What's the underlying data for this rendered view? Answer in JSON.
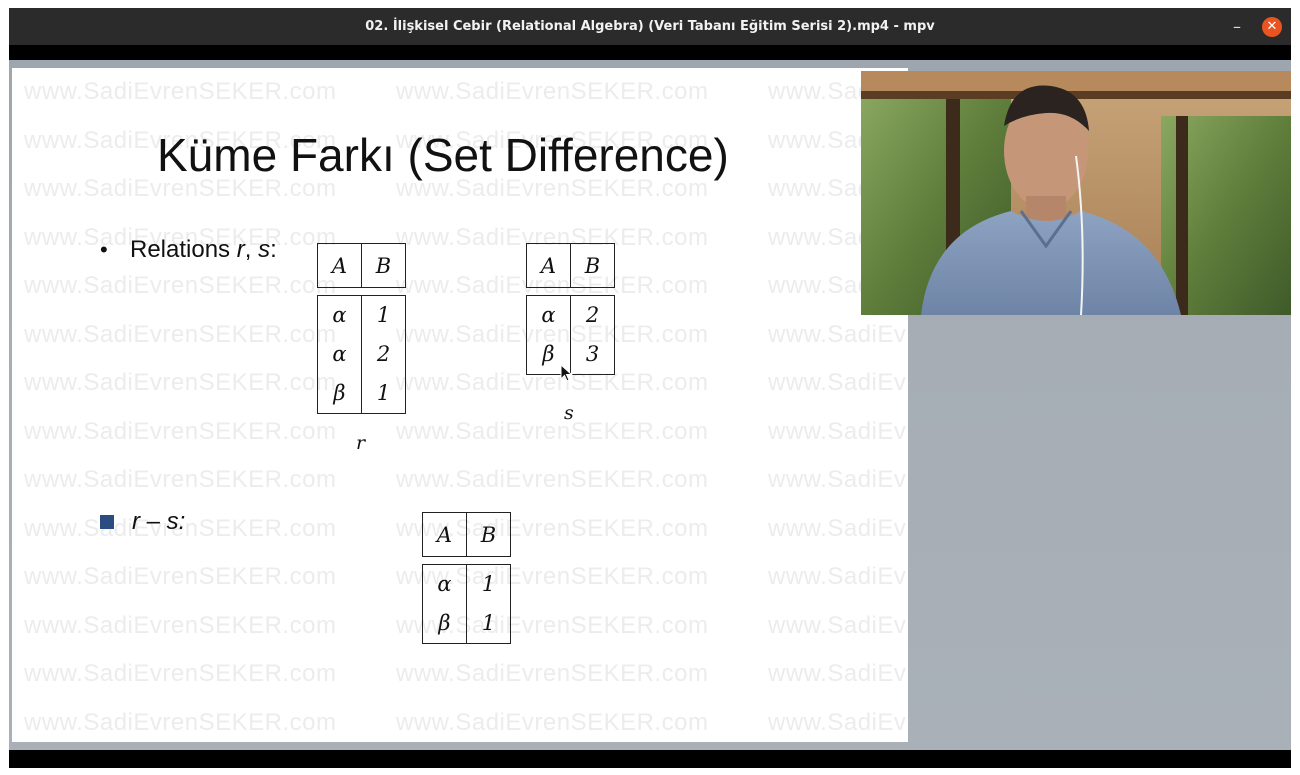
{
  "window": {
    "title": "02. İlişkisel Cebir (Relational Algebra) (Veri Tabanı Eğitim Serisi 2).mp4 - mpv",
    "minimize_glyph": "–",
    "close_glyph": "✕"
  },
  "slide": {
    "watermark_text": "www.SadiEvrenSEKER.com",
    "title": "Küme Farkı (Set Difference)",
    "bullet1": {
      "prefix": "Relations ",
      "r": "r",
      "sep": ", ",
      "s": "s",
      "suffix": ":"
    },
    "bullet2": {
      "text": "r – s:"
    },
    "relation_r": {
      "label": "r",
      "headers": [
        "A",
        "B"
      ],
      "col_a": [
        "α",
        "α",
        "β"
      ],
      "col_b": [
        "1",
        "2",
        "1"
      ]
    },
    "relation_s": {
      "label": "s",
      "headers": [
        "A",
        "B"
      ],
      "col_a": [
        "α",
        "β"
      ],
      "col_b": [
        "2",
        "3"
      ]
    },
    "relation_result": {
      "headers": [
        "A",
        "B"
      ],
      "col_a": [
        "α",
        "β"
      ],
      "col_b": [
        "1",
        "1"
      ]
    }
  },
  "icons": {
    "close": "close-icon",
    "minimize": "minimize-icon",
    "cursor": "mouse-cursor-icon"
  },
  "colors": {
    "titlebar": "#2b2b2b",
    "close_button": "#e95420",
    "bullet_square": "#2a4c80",
    "video_bg": "#a6adb5"
  }
}
